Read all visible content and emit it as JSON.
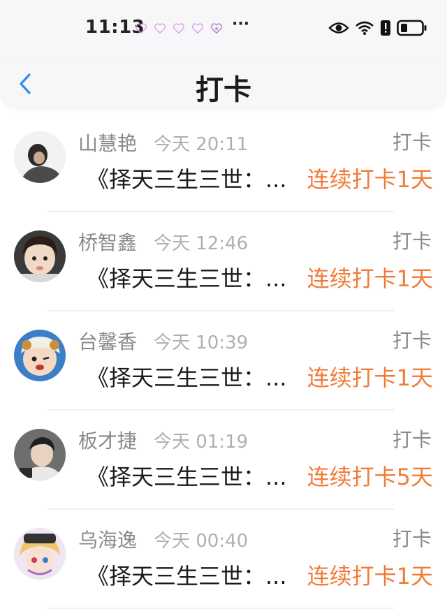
{
  "status_bar": {
    "time": "11:13",
    "more": "···"
  },
  "header": {
    "title": "打卡",
    "back_icon": "chevron-left-icon"
  },
  "colors": {
    "accent_blue": "#2d8cf0",
    "streak_orange": "#f07c3a",
    "name_gray": "#8a8a8a",
    "time_gray": "#b0b0b0"
  },
  "items": [
    {
      "name": "山慧艳",
      "time": "今天 20:11",
      "type": "打卡",
      "title": "《择天三生三世：...",
      "streak": "连续打卡1天"
    },
    {
      "name": "桥智鑫",
      "time": "今天 12:46",
      "type": "打卡",
      "title": "《择天三生三世：...",
      "streak": "连续打卡1天"
    },
    {
      "name": "台馨香",
      "time": "今天 10:39",
      "type": "打卡",
      "title": "《择天三生三世：...",
      "streak": "连续打卡1天"
    },
    {
      "name": "板才捷",
      "time": "今天 01:19",
      "type": "打卡",
      "title": "《择天三生三世：...",
      "streak": "连续打卡5天"
    },
    {
      "name": "乌海逸",
      "time": "今天 00:40",
      "type": "打卡",
      "title": "《择天三生三世：...",
      "streak": "连续打卡1天"
    }
  ]
}
